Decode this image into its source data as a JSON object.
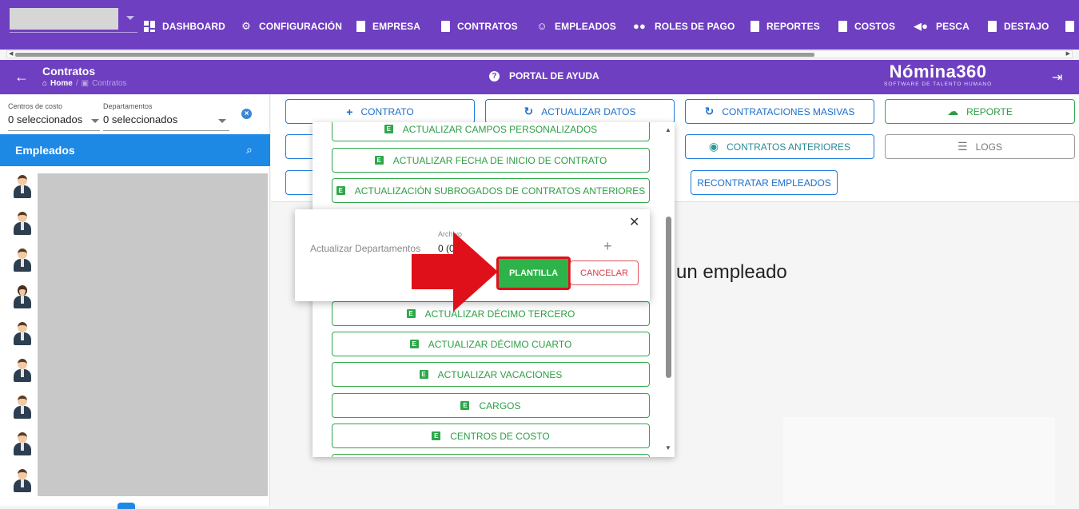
{
  "nav": {
    "items": [
      {
        "label": "DASHBOARD",
        "icon": "dashboard-icon"
      },
      {
        "label": "CONFIGURACIÓN",
        "icon": "gear-icon"
      },
      {
        "label": "EMPRESA",
        "icon": "building-icon"
      },
      {
        "label": "CONTRATOS",
        "icon": "clipboard-icon"
      },
      {
        "label": "EMPLEADOS",
        "icon": "employees-icon"
      },
      {
        "label": "ROLES DE PAGO",
        "icon": "group-icon"
      },
      {
        "label": "REPORTES",
        "icon": "clipboard-icon"
      },
      {
        "label": "COSTOS",
        "icon": "invoice-icon"
      },
      {
        "label": "PESCA",
        "icon": "fish-icon"
      },
      {
        "label": "DESTAJO",
        "icon": "document-icon"
      }
    ]
  },
  "header": {
    "title": "Contratos",
    "breadcrumb_home": "Home",
    "breadcrumb_current": "Contratos",
    "help": "PORTAL DE AYUDA",
    "logo": "Nómina360",
    "logo_tagline": "SOFTWARE DE TALENTO HUMANO"
  },
  "filters": {
    "cost_centers_label": "Centros de costo",
    "cost_centers_value": "0 seleccionados",
    "departments_label": "Departamentos",
    "departments_value": "0 seleccionados"
  },
  "employees": {
    "title": "Empleados",
    "avatars": [
      "m",
      "m",
      "m",
      "f",
      "m",
      "m",
      "m",
      "m",
      "m"
    ]
  },
  "toolbar": {
    "contrato": "CONTRATO",
    "actualizar_datos": "ACTUALIZAR DATOS",
    "contrataciones_masivas": "CONTRATACIONES MASIVAS",
    "reporte": "REPORTE",
    "contratos_anteriores": "CONTRATOS ANTERIORES",
    "logs": "LOGS",
    "recontratar": "RECONTRATAR EMPLEADOS"
  },
  "dropdown": {
    "items": [
      "ACTUALIZAR CAMPOS PERSONALIZADOS",
      "ACTUALIZAR FECHA DE INICIO DE CONTRATO",
      "ACTUALIZACIÓN SUBROGADOS DE CONTRATOS ANTERIORES",
      "ACTUALIZAR DÉCIMO TERCERO",
      "ACTUALIZAR DÉCIMO CUARTO",
      "ACTUALIZAR VACACIONES",
      "CARGOS",
      "CENTROS DE COSTO"
    ]
  },
  "modal": {
    "label": "Actualizar Departamentos",
    "file_label": "Archivo",
    "file_value": "0 (0 B)",
    "plantilla": "PLANTILLA",
    "cancelar": "CANCELAR"
  },
  "main": {
    "placeholder_text": "un empleado"
  },
  "colors": {
    "primary_purple": "#6f3fc1",
    "blue": "#1e88e5",
    "green": "#2ea84a",
    "red_annotation": "#e0101a"
  }
}
